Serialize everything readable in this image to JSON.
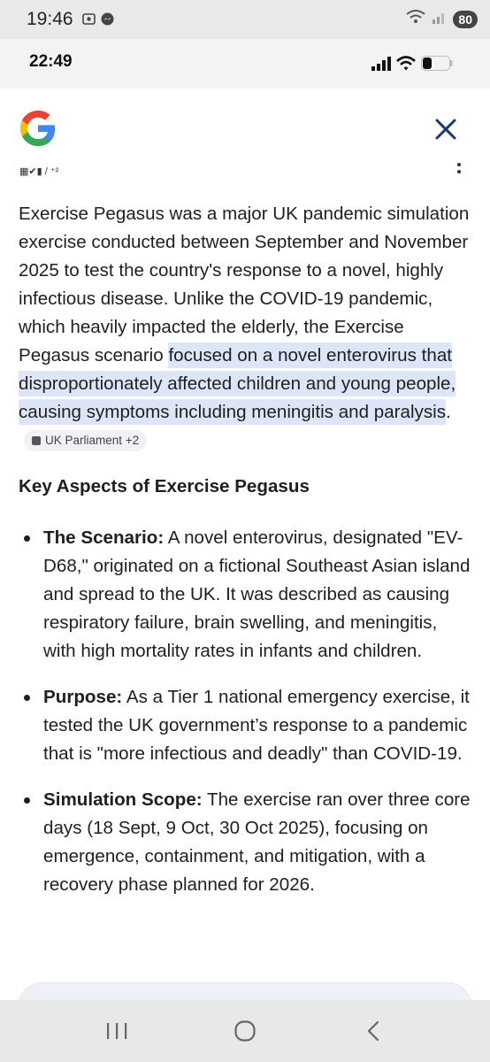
{
  "outer_status": {
    "time": "19:46",
    "battery": "80"
  },
  "inner_status": {
    "time": "22:49"
  },
  "header": {
    "source_glyphs": "▦✔▮ / ⁺²"
  },
  "answer": {
    "text_plain": "Exercise Pegasus was a major UK pandemic simulation exercise conducted between September and November 2025 to test the country's response to a novel, highly infectious disease. Unlike the COVID-19 pandemic, which heavily impacted the elderly, the Exercise Pegasus scenario ",
    "text_highlight": "focused on a novel enterovirus that disproportionately affected children and young people, causing symptoms including meningitis and paralysis",
    "text_end": ".",
    "source_chip": "UK Parliament +2"
  },
  "section": {
    "heading": "Key Aspects of Exercise Pegasus"
  },
  "bullets": [
    {
      "label": "The Scenario:",
      "text": " A novel enterovirus, designated \"EV-D68,\" originated on a fictional Southeast Asian island and spread to the UK. It was described as causing respiratory failure, brain swelling, and meningitis, with high mortality rates in infants and children."
    },
    {
      "label": "Purpose:",
      "text": " As a Tier 1 national emergency exercise, it tested the UK government’s response to a pandemic that is \"more infectious and deadly\" than COVID-19."
    },
    {
      "label": "Simulation Scope:",
      "text": " The exercise ran over three core days (18 Sept, 9 Oct, 30 Oct 2025), focusing on emergence, containment, and mitigation, with a recovery phase planned for 2026."
    }
  ]
}
